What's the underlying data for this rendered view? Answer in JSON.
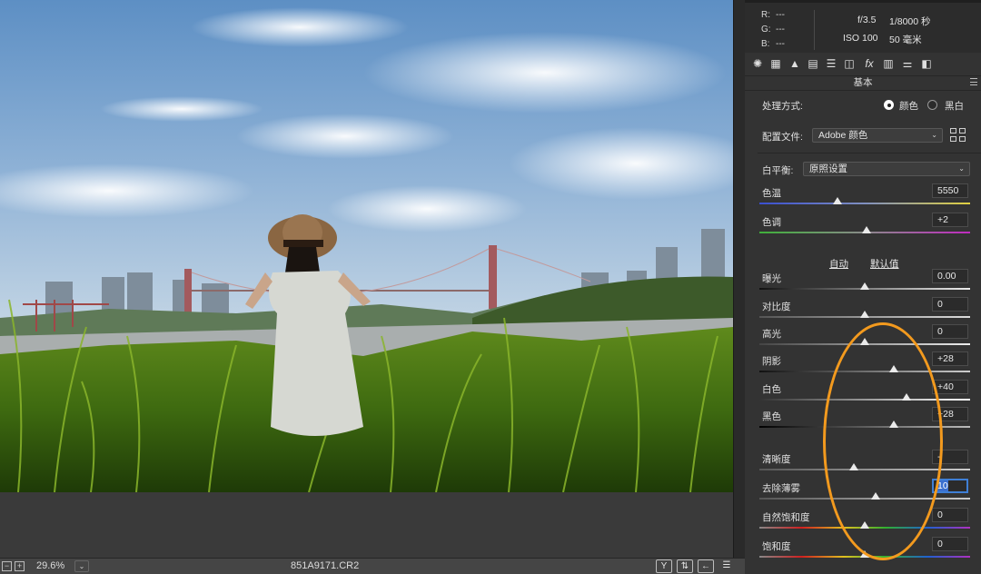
{
  "status_bar": {
    "zoom": "29.6%",
    "filename": "851A9171.CR2",
    "icons": [
      "fit-icon",
      "zoom-in-icon",
      "zoom-dropdown-icon",
      "y-compare-icon",
      "swap-icon",
      "copy-settings-icon",
      "preferences-icon"
    ]
  },
  "info": {
    "r_label": "R:",
    "r_value": "---",
    "g_label": "G:",
    "g_value": "---",
    "b_label": "B:",
    "b_value": "---",
    "aperture": "f/3.5",
    "shutter": "1/8000 秒",
    "iso": "ISO 100",
    "focal": "50 毫米"
  },
  "panel_tabs": [
    "aperture-icon",
    "grid-icon",
    "mountains-icon",
    "split-icon",
    "hsl-icon",
    "lens-icon",
    "fx-icon",
    "camera-calibration-icon",
    "presets-icon",
    "snapshots-icon"
  ],
  "section_title": "基本",
  "treatment": {
    "label": "处理方式:",
    "color_label": "颜色",
    "bw_label": "黑白",
    "selected": "颜色"
  },
  "profile": {
    "label": "配置文件:",
    "value": "Adobe 颜色"
  },
  "white_balance": {
    "label": "白平衡:",
    "value": "原照设置"
  },
  "links": {
    "auto": "自动",
    "default": "默认值"
  },
  "sliders": [
    {
      "label": "色温",
      "value": "5550",
      "level": 0.37
    },
    {
      "label": "色调",
      "value": "+2",
      "level": 0.51
    },
    {
      "label": "曝光",
      "value": "0.00",
      "level": 0.5
    },
    {
      "label": "对比度",
      "value": "0",
      "level": 0.5
    },
    {
      "label": "高光",
      "value": "0",
      "level": 0.5
    },
    {
      "label": "阴影",
      "value": "+28",
      "level": 0.64
    },
    {
      "label": "白色",
      "value": "+40",
      "level": 0.7
    },
    {
      "label": "黑色",
      "value": "+28",
      "level": 0.64
    },
    {
      "label": "清晰度",
      "value": "-",
      "level": 0.45
    },
    {
      "label": "去除薄雾",
      "value": "10",
      "level": 0.55
    },
    {
      "label": "自然饱和度",
      "value": "0",
      "level": 0.5
    },
    {
      "label": "饱和度",
      "value": "0",
      "level": 0.5
    }
  ],
  "colors": {
    "panel": "#333333",
    "annotation": "#f39a1e",
    "focus": "#3f7fd6"
  }
}
